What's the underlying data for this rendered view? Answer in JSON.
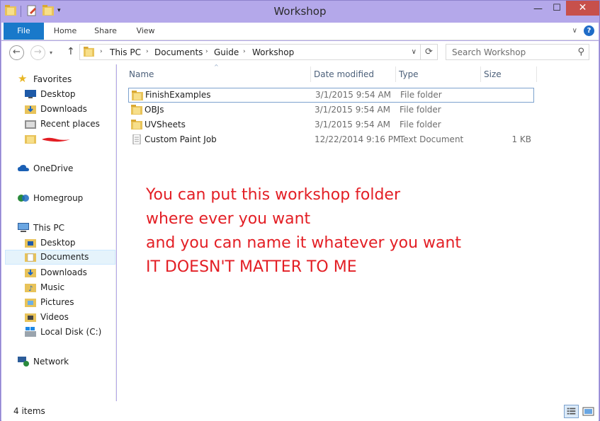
{
  "window": {
    "title": "Workshop",
    "min_glyph": "—",
    "max_glyph": "☐",
    "close_glyph": "✕"
  },
  "ribbon": {
    "tabs": [
      {
        "label": "File"
      },
      {
        "label": "Home"
      },
      {
        "label": "Share"
      },
      {
        "label": "View"
      }
    ],
    "help_glyph": "?"
  },
  "address": {
    "breadcrumbs": [
      "This PC",
      "Documents",
      "Guide",
      "Workshop"
    ],
    "search_placeholder": "Search Workshop"
  },
  "nav_pane": {
    "favorites": {
      "header": "Favorites",
      "items": [
        {
          "label": "Desktop",
          "icon": "desktop-icon"
        },
        {
          "label": "Downloads",
          "icon": "downloads-icon"
        },
        {
          "label": "Recent places",
          "icon": "recent-places-icon"
        },
        {
          "label": "",
          "icon": "folder-icon"
        }
      ]
    },
    "onedrive": "OneDrive",
    "homegroup": "Homegroup",
    "this_pc": {
      "header": "This PC",
      "items": [
        {
          "label": "Desktop",
          "icon": "desktop-folder-icon"
        },
        {
          "label": "Documents",
          "icon": "documents-icon",
          "selected": true
        },
        {
          "label": "Downloads",
          "icon": "downloads-icon"
        },
        {
          "label": "Music",
          "icon": "music-icon"
        },
        {
          "label": "Pictures",
          "icon": "pictures-icon"
        },
        {
          "label": "Videos",
          "icon": "videos-icon"
        },
        {
          "label": "Local Disk (C:)",
          "icon": "local-disk-icon"
        }
      ]
    },
    "network": "Network"
  },
  "file_list": {
    "columns": [
      "Name",
      "Date modified",
      "Type",
      "Size"
    ],
    "rows": [
      {
        "name": "FinishExamples",
        "date": "3/1/2015 9:54 AM",
        "type": "File folder",
        "size": "",
        "icon": "folder-icon"
      },
      {
        "name": "OBJs",
        "date": "3/1/2015 9:54 AM",
        "type": "File folder",
        "size": "",
        "icon": "folder-icon"
      },
      {
        "name": "UVSheets",
        "date": "3/1/2015 9:54 AM",
        "type": "File folder",
        "size": "",
        "icon": "folder-icon"
      },
      {
        "name": "Custom Paint Job",
        "date": "12/22/2014 9:16 PM",
        "type": "Text Document",
        "size": "1 KB",
        "icon": "text-document-icon"
      }
    ]
  },
  "annotation": {
    "lines": [
      "You can put this workshop folder",
      "where ever you want",
      "and you can name it whatever you want",
      "IT DOESN'T MATTER TO ME"
    ],
    "color": "#e31e24"
  },
  "status": {
    "item_count": "4 items"
  },
  "colors": {
    "titlebar": "#b4a8ea",
    "file_tab": "#1979ca",
    "close_button": "#c7504b",
    "selection": "#e5f3fb"
  }
}
